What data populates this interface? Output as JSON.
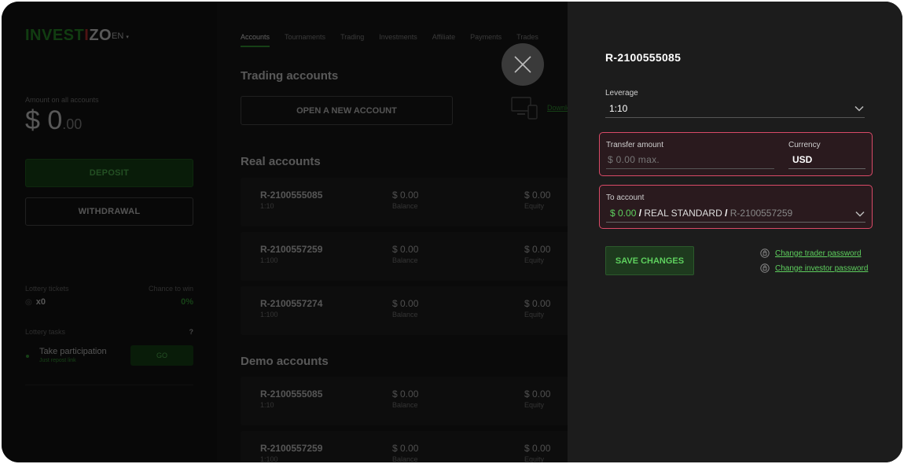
{
  "brand": {
    "logo_text_1": "INVEST",
    "logo_text_2": "I",
    "logo_text_3": "ZO",
    "language": "EN",
    "accent_color": "#3aa83a"
  },
  "sidebar": {
    "amount_label": "Amount on all accounts",
    "amount_int": "$ 0",
    "amount_dec": ".00",
    "deposit_label": "DEPOSIT",
    "withdraw_label": "WITHDRAWAL",
    "lottery_tickets_label": "Lottery tickets",
    "chance_label": "Chance to win",
    "tickets_value": "x0",
    "chance_value": "0%",
    "lottery_tasks_label": "Lottery tasks",
    "tasks_help": "?",
    "task_title": "Take participation",
    "task_sub": "Just repost link",
    "task_go": "GO"
  },
  "nav": {
    "tabs": [
      "Accounts",
      "Tournaments",
      "Trading",
      "Investments",
      "Affiliate",
      "Payments",
      "Trades"
    ]
  },
  "main": {
    "trading_title": "Trading accounts",
    "open_account_label": "OPEN A NEW ACCOUNT",
    "download_label": "Download",
    "real_title": "Real accounts",
    "demo_title": "Demo accounts",
    "balance_label": "Balance",
    "equity_label": "Equity",
    "real_accounts": [
      {
        "id": "R-2100555085",
        "leverage": "1:10",
        "balance": "$ 0.00",
        "equity": "$ 0.00"
      },
      {
        "id": "R-2100557259",
        "leverage": "1:100",
        "balance": "$ 0.00",
        "equity": "$ 0.00"
      },
      {
        "id": "R-2100557274",
        "leverage": "1:100",
        "balance": "$ 0.00",
        "equity": "$ 0.00"
      }
    ],
    "demo_accounts": [
      {
        "id": "R-2100555085",
        "leverage": "1:10",
        "balance": "$ 0.00",
        "equity": "$ 0.00"
      },
      {
        "id": "R-2100557259",
        "leverage": "1:100",
        "balance": "$ 0.00",
        "equity": "$ 0.00"
      }
    ]
  },
  "panel": {
    "title": "R-2100555085",
    "leverage_label": "Leverage",
    "leverage_value": "1:10",
    "transfer_label": "Transfer amount",
    "transfer_placeholder": "$ 0.00 max.",
    "currency_label": "Currency",
    "currency_value": "USD",
    "to_account_label": "To account",
    "to_amount": "$ 0.00",
    "to_sep1": " / ",
    "to_plan": "REAL STANDARD",
    "to_sep2": " / ",
    "to_id": "R-2100557259",
    "save_label": "SAVE CHANGES",
    "change_trader_pw": "Change trader password",
    "change_investor_pw": "Change investor password",
    "error_color": "#d94a67"
  }
}
